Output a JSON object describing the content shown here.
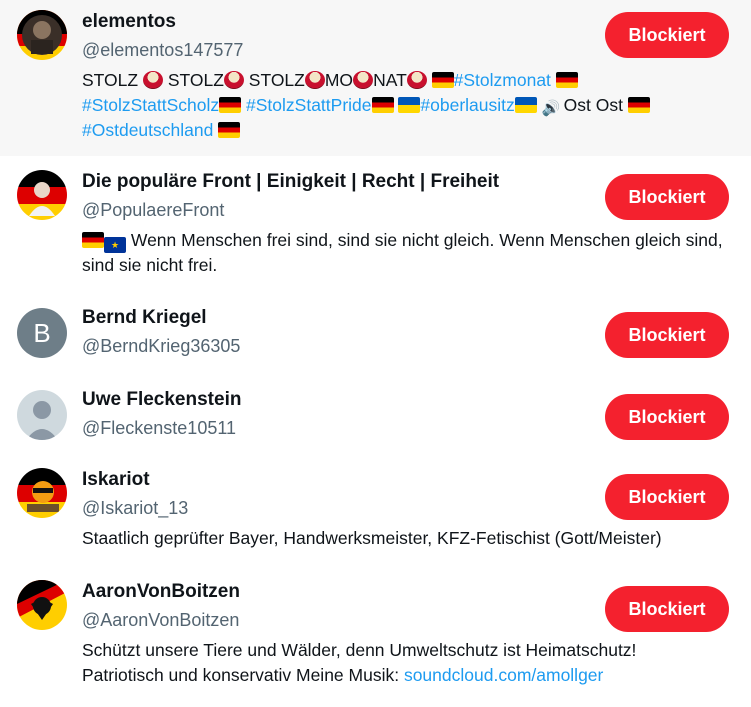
{
  "users": [
    {
      "name": "elementos",
      "handle": "@elementos147577",
      "button": "Blockiert",
      "avatar_icon": "person-photo-icon"
    },
    {
      "name": "Die populäre Front | Einigkeit | Recht | Freiheit",
      "handle": "@PopulaereFront",
      "button": "Blockiert",
      "bio": "Wenn Menschen frei sind, sind sie nicht gleich. Wenn Menschen gleich sind, sind sie nicht frei."
    },
    {
      "name": "Bernd Kriegel",
      "handle": "@BerndKrieg36305",
      "button": "Blockiert",
      "initial": "B"
    },
    {
      "name": "Uwe Fleckenstein",
      "handle": "@Fleckenste10511",
      "button": "Blockiert"
    },
    {
      "name": "Iskariot",
      "handle": "@Iskariot_13",
      "button": "Blockiert",
      "bio": "Staatlich geprüfter Bayer, Handwerksmeister, KFZ-Fetischist (Gott/Meister)"
    },
    {
      "name": "AaronVonBoitzen",
      "handle": "@AaronVonBoitzen",
      "button": "Blockiert",
      "bio_line1": "Schützt unsere Tiere und Wälder, denn Umweltschutz ist Heimatschutz!",
      "bio_line2_text": "Patriotisch und konservativ Meine Musik: ",
      "bio_link": "soundcloud.com/amollger"
    }
  ],
  "bio0": {
    "t1": "STOLZ ",
    "t2": " STOLZ",
    "t3": " STOLZ",
    "t4": "MO",
    "t5": "NAT",
    "tag1": "#Stolzmonat",
    "tag2": "#StolzStattScholz",
    "tag3": "#StolzStattPride",
    "tag4": "#oberlausitz",
    "t6": "Ost Ost ",
    "tag5": "#Ostdeutschland"
  },
  "colors": {
    "button": "#f4212e",
    "link": "#1d9bf0",
    "handle": "#536471",
    "highlight_bg": "#f7f7f7"
  }
}
